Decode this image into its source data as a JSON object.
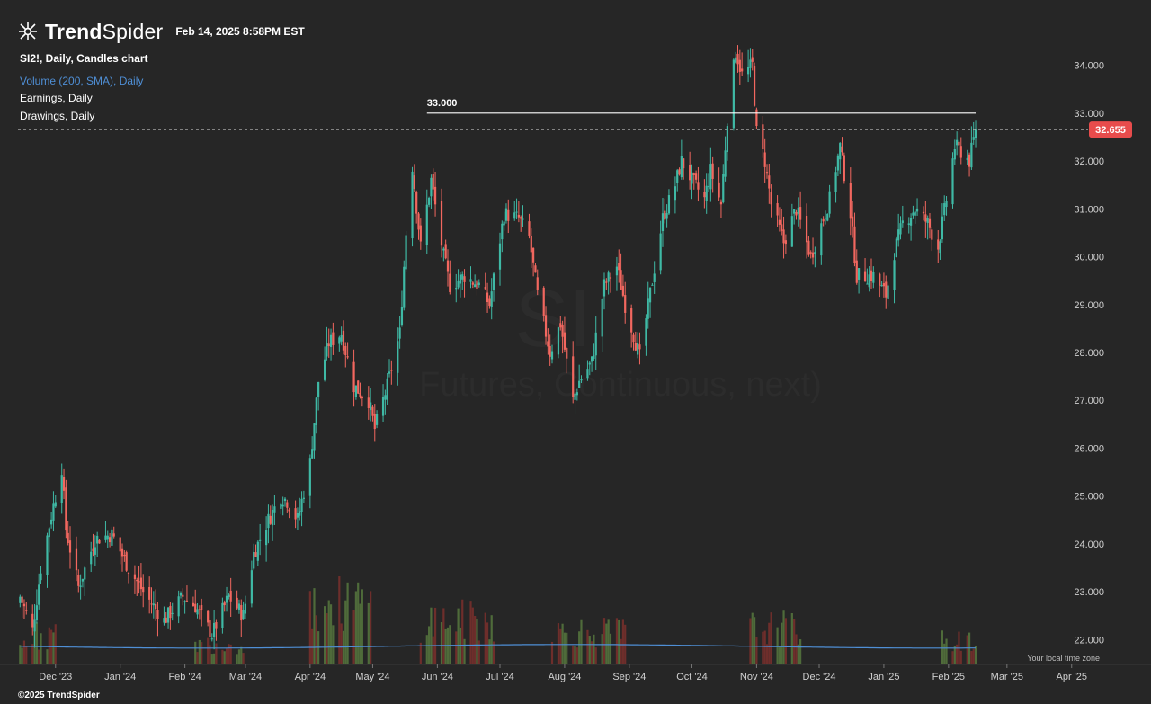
{
  "brand": {
    "name_bold": "Trend",
    "name_light": "Spider",
    "timestamp": "Feb 14, 2025 8:58PM EST"
  },
  "legend": {
    "symbol": "SI2!, Daily, Candles chart",
    "volume": "Volume (200, SMA), Daily",
    "earnings": "Earnings, Daily",
    "drawings": "Drawings, Daily"
  },
  "watermark": {
    "symbol": "SI",
    "name": "Futures, Continuous, next)"
  },
  "footer": {
    "copyright": "©2025 TrendSpider",
    "timezone": "Your local time zone"
  },
  "colors": {
    "up": "#3fb9a5",
    "down": "#f2675f",
    "vol_up": "#4f6b3a",
    "vol_down": "#6e2e2b",
    "sma": "#4f8fd6",
    "price_tag": "#e84c4c",
    "background": "#262626"
  },
  "chart_data": {
    "type": "candlestick",
    "series_name": "SI2!",
    "timeframe": "Daily",
    "last_price": 32.655,
    "last_price_label": "32.655",
    "horizontal_line": {
      "value": 33.0,
      "label": "33.000",
      "from_month": "2024-05-27",
      "to_month": "2025-02-14"
    },
    "ylim": [
      21.5,
      34.8
    ],
    "yticks": [
      22,
      23,
      24,
      25,
      26,
      27,
      28,
      29,
      30,
      31,
      32,
      33,
      34
    ],
    "ytick_labels": [
      "22.000",
      "23.000",
      "24.000",
      "25.000",
      "26.000",
      "27.000",
      "28.000",
      "29.000",
      "30.000",
      "31.000",
      "32.000",
      "33.000",
      "34.000"
    ],
    "xticks": [
      {
        "label": "Dec '23",
        "date": "2023-12-01"
      },
      {
        "label": "Jan '24",
        "date": "2024-01-01"
      },
      {
        "label": "Feb '24",
        "date": "2024-02-01"
      },
      {
        "label": "Mar '24",
        "date": "2024-03-01"
      },
      {
        "label": "Apr '24",
        "date": "2024-04-01"
      },
      {
        "label": "May '24",
        "date": "2024-05-01"
      },
      {
        "label": "Jun '24",
        "date": "2024-06-01"
      },
      {
        "label": "Jul '24",
        "date": "2024-07-01"
      },
      {
        "label": "Aug '24",
        "date": "2024-08-01"
      },
      {
        "label": "Sep '24",
        "date": "2024-09-01"
      },
      {
        "label": "Oct '24",
        "date": "2024-10-01"
      },
      {
        "label": "Nov '24",
        "date": "2024-11-01"
      },
      {
        "label": "Dec '24",
        "date": "2024-12-01"
      },
      {
        "label": "Jan '25",
        "date": "2025-01-01"
      },
      {
        "label": "Feb '25",
        "date": "2025-02-01"
      },
      {
        "label": "Mar '25",
        "date": "2025-03-01"
      },
      {
        "label": "Apr '25",
        "date": "2025-04-01"
      }
    ],
    "close_waypoints": [
      [
        "2023-11-14",
        22.9
      ],
      [
        "2023-11-20",
        22.2
      ],
      [
        "2023-11-24",
        23.5
      ],
      [
        "2023-11-29",
        24.6
      ],
      [
        "2023-12-04",
        25.6
      ],
      [
        "2023-12-06",
        24.3
      ],
      [
        "2023-12-12",
        23.1
      ],
      [
        "2023-12-20",
        24.1
      ],
      [
        "2023-12-28",
        24.2
      ],
      [
        "2024-01-05",
        23.5
      ],
      [
        "2024-01-12",
        23.0
      ],
      [
        "2024-01-22",
        22.4
      ],
      [
        "2024-01-31",
        22.9
      ],
      [
        "2024-02-06",
        22.7
      ],
      [
        "2024-02-14",
        22.1
      ],
      [
        "2024-02-22",
        22.9
      ],
      [
        "2024-02-29",
        22.5
      ],
      [
        "2024-03-05",
        23.8
      ],
      [
        "2024-03-12",
        24.5
      ],
      [
        "2024-03-18",
        25.0
      ],
      [
        "2024-03-21",
        24.9
      ],
      [
        "2024-03-26",
        24.5
      ],
      [
        "2024-04-01",
        25.7
      ],
      [
        "2024-04-05",
        27.4
      ],
      [
        "2024-04-10",
        28.2
      ],
      [
        "2024-04-16",
        28.4
      ],
      [
        "2024-04-22",
        27.3
      ],
      [
        "2024-04-29",
        27.0
      ],
      [
        "2024-05-02",
        26.4
      ],
      [
        "2024-05-08",
        27.3
      ],
      [
        "2024-05-14",
        28.4
      ],
      [
        "2024-05-17",
        30.5
      ],
      [
        "2024-05-20",
        31.9
      ],
      [
        "2024-05-24",
        30.2
      ],
      [
        "2024-05-29",
        31.6
      ],
      [
        "2024-06-04",
        30.0
      ],
      [
        "2024-06-07",
        29.4
      ],
      [
        "2024-06-14",
        29.6
      ],
      [
        "2024-06-21",
        29.4
      ],
      [
        "2024-06-26",
        29.0
      ],
      [
        "2024-07-03",
        30.9
      ],
      [
        "2024-07-10",
        30.8
      ],
      [
        "2024-07-15",
        30.4
      ],
      [
        "2024-07-19",
        29.2
      ],
      [
        "2024-07-25",
        28.0
      ],
      [
        "2024-07-30",
        28.6
      ],
      [
        "2024-08-05",
        27.0
      ],
      [
        "2024-08-08",
        27.4
      ],
      [
        "2024-08-14",
        27.8
      ],
      [
        "2024-08-20",
        29.4
      ],
      [
        "2024-08-26",
        29.8
      ],
      [
        "2024-08-30",
        29.0
      ],
      [
        "2024-09-06",
        27.9
      ],
      [
        "2024-09-12",
        29.5
      ],
      [
        "2024-09-17",
        30.8
      ],
      [
        "2024-09-23",
        31.5
      ],
      [
        "2024-09-26",
        32.0
      ],
      [
        "2024-10-01",
        31.6
      ],
      [
        "2024-10-07",
        31.2
      ],
      [
        "2024-10-10",
        31.8
      ],
      [
        "2024-10-15",
        31.1
      ],
      [
        "2024-10-18",
        32.9
      ],
      [
        "2024-10-22",
        34.3
      ],
      [
        "2024-10-25",
        33.8
      ],
      [
        "2024-10-30",
        34.0
      ],
      [
        "2024-11-01",
        32.6
      ],
      [
        "2024-11-05",
        32.0
      ],
      [
        "2024-11-08",
        31.1
      ],
      [
        "2024-11-14",
        30.3
      ],
      [
        "2024-11-20",
        31.0
      ],
      [
        "2024-11-27",
        30.0
      ],
      [
        "2024-12-03",
        30.8
      ],
      [
        "2024-12-06",
        31.2
      ],
      [
        "2024-12-11",
        32.3
      ],
      [
        "2024-12-16",
        30.9
      ],
      [
        "2024-12-19",
        29.6
      ],
      [
        "2024-12-27",
        29.6
      ],
      [
        "2025-01-02",
        29.2
      ],
      [
        "2025-01-06",
        30.1
      ],
      [
        "2025-01-10",
        30.7
      ],
      [
        "2025-01-16",
        31.0
      ],
      [
        "2025-01-22",
        30.7
      ],
      [
        "2025-01-27",
        30.2
      ],
      [
        "2025-01-31",
        31.2
      ],
      [
        "2025-02-04",
        32.3
      ],
      [
        "2025-02-07",
        32.2
      ],
      [
        "2025-02-11",
        32.0
      ],
      [
        "2025-02-14",
        32.655
      ]
    ],
    "volume_clusters": [
      {
        "start": "2023-11-14",
        "end": "2023-12-01",
        "level": 0.35
      },
      {
        "start": "2024-02-06",
        "end": "2024-02-29",
        "level": 0.25
      },
      {
        "start": "2024-04-01",
        "end": "2024-04-30",
        "level": 0.75
      },
      {
        "start": "2024-05-24",
        "end": "2024-06-28",
        "level": 0.55
      },
      {
        "start": "2024-07-26",
        "end": "2024-08-30",
        "level": 0.4
      },
      {
        "start": "2024-10-29",
        "end": "2024-11-22",
        "level": 0.45
      },
      {
        "start": "2025-01-29",
        "end": "2025-02-14",
        "level": 0.28
      }
    ],
    "volume_sma_level": 0.16
  }
}
